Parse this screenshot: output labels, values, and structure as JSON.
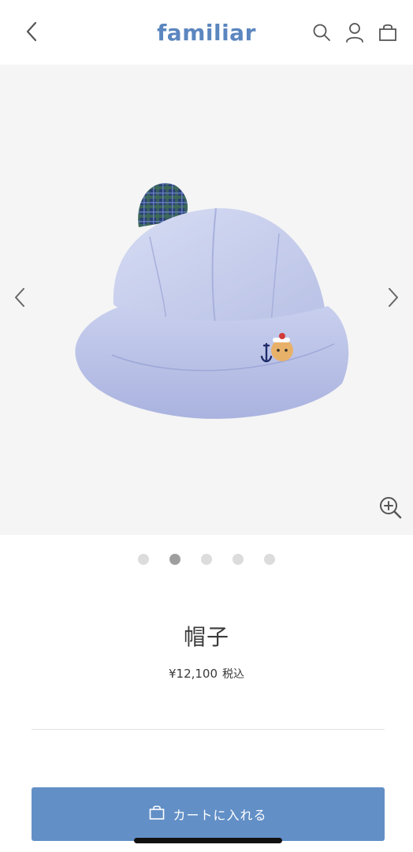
{
  "header": {
    "logo_text": "familiar",
    "icons": [
      "back-chevron-icon",
      "search-icon",
      "user-icon",
      "bag-icon"
    ]
  },
  "gallery": {
    "image_label": "blue seersucker bucket hat with plaid bear ears",
    "slide_count": 5,
    "active_slide": 2,
    "icons": [
      "chevron-left-icon",
      "chevron-right-icon",
      "zoom-in-icon"
    ]
  },
  "product": {
    "name": "帽子",
    "price": "¥12,100",
    "tax_label": "税込"
  },
  "cart": {
    "label": "カートに入れる",
    "icon": "bag-icon"
  },
  "colors": {
    "brand": "#5b86bf",
    "cart_button": "#628fc6",
    "gallery_bg": "#f5f5f5",
    "dot_inactive": "#dcdcdc",
    "dot_active": "#9e9e9e"
  }
}
